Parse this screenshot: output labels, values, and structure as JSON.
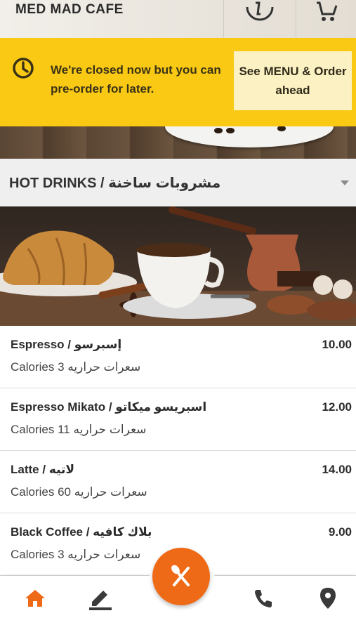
{
  "header": {
    "brand": "MED MAD CAFE",
    "icons": [
      "info-icon",
      "cart-icon"
    ]
  },
  "notice": {
    "message": "We're closed now but you can pre-order for later.",
    "cta_label": "See MENU & Order ahead"
  },
  "category": {
    "title": "HOT DRINKS / مشروبات ساخنة"
  },
  "items": [
    {
      "name": "Espresso / إسبرسو",
      "calories": "Calories 3 سعرات حراريه",
      "price": "10.00"
    },
    {
      "name": "Espresso Mikato / اسبريسو ميكاتو",
      "calories": "Calories 11 سعرات حراريه",
      "price": "12.00"
    },
    {
      "name": "Latte / لاتيه",
      "calories": "Calories 60 سعرات حراريه",
      "price": "14.00"
    },
    {
      "name": "Black Coffee / بلاك كافيه",
      "calories": "Calories 3 سعرات حراريه",
      "price": "9.00"
    }
  ],
  "nav": {
    "items": [
      "home-icon",
      "edit-icon",
      "menu-icon",
      "phone-icon",
      "location-icon"
    ],
    "active": "home-icon"
  },
  "colors": {
    "banner": "#f9c914",
    "accent": "#ef6a16",
    "nav_icon": "#3a3a3a"
  }
}
